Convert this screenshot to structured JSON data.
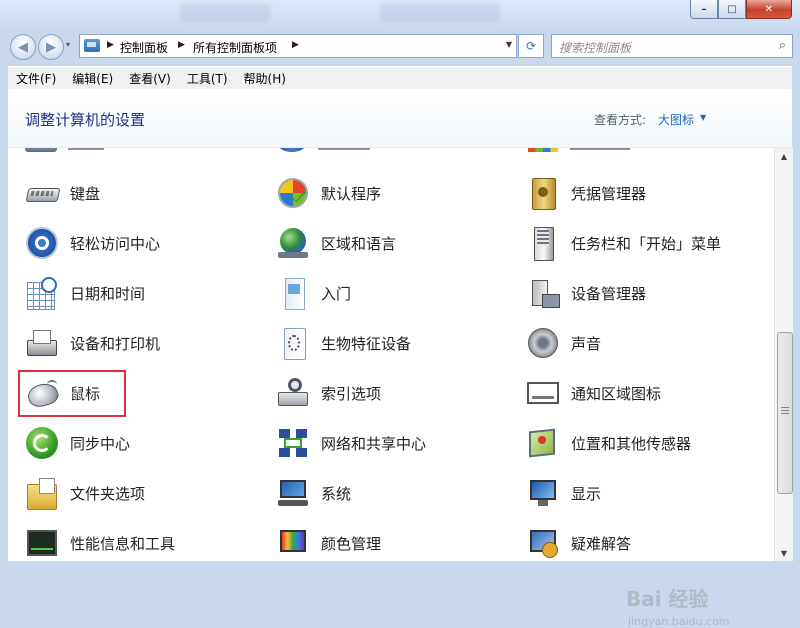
{
  "window": {
    "controls": [
      "–",
      "□",
      "✕"
    ]
  },
  "nav": {
    "back_icon": "back-arrow-icon",
    "forward_icon": "forward-arrow-icon",
    "dropdown_icon": "▾"
  },
  "address": {
    "crumbs": [
      "控制面板",
      "所有控制面板项"
    ],
    "refresh_icon": "⟳"
  },
  "search": {
    "placeholder": "搜索控制面板"
  },
  "menu": [
    "文件(F)",
    "编辑(E)",
    "查看(V)",
    "工具(T)",
    "帮助(H)"
  ],
  "header": {
    "title": "调整计算机的设置",
    "view_label": "查看方式:",
    "view_value": "大图标"
  },
  "items": [
    {
      "label": "键盘",
      "icon": "keyboard-icon"
    },
    {
      "label": "默认程序",
      "icon": "default-programs-icon"
    },
    {
      "label": "凭据管理器",
      "icon": "credential-manager-icon"
    },
    {
      "label": "轻松访问中心",
      "icon": "ease-of-access-icon"
    },
    {
      "label": "区域和语言",
      "icon": "region-language-icon"
    },
    {
      "label": "任务栏和「开始」菜单",
      "icon": "taskbar-start-menu-icon"
    },
    {
      "label": "日期和时间",
      "icon": "date-time-icon"
    },
    {
      "label": "入门",
      "icon": "getting-started-icon"
    },
    {
      "label": "设备管理器",
      "icon": "device-manager-icon"
    },
    {
      "label": "设备和打印机",
      "icon": "devices-printers-icon"
    },
    {
      "label": "生物特征设备",
      "icon": "biometric-devices-icon"
    },
    {
      "label": "声音",
      "icon": "sound-icon"
    },
    {
      "label": "鼠标",
      "icon": "mouse-icon"
    },
    {
      "label": "索引选项",
      "icon": "indexing-options-icon"
    },
    {
      "label": "通知区域图标",
      "icon": "notification-area-icon"
    },
    {
      "label": "同步中心",
      "icon": "sync-center-icon"
    },
    {
      "label": "网络和共享中心",
      "icon": "network-sharing-icon"
    },
    {
      "label": "位置和其他传感器",
      "icon": "location-sensors-icon"
    },
    {
      "label": "文件夹选项",
      "icon": "folder-options-icon"
    },
    {
      "label": "系统",
      "icon": "system-icon"
    },
    {
      "label": "显示",
      "icon": "display-icon"
    },
    {
      "label": "性能信息和工具",
      "icon": "performance-icon"
    },
    {
      "label": "颜色管理",
      "icon": "color-management-icon"
    },
    {
      "label": "疑难解答",
      "icon": "troubleshooting-icon"
    }
  ],
  "watermark": {
    "text": "Bai 经验",
    "sub": "jingyan.baidu.com"
  }
}
